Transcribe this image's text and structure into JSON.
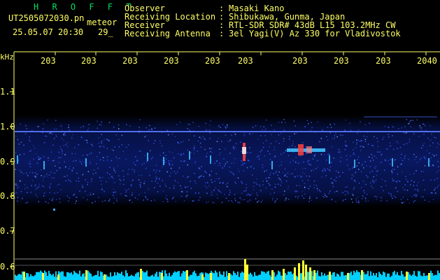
{
  "header": {
    "brand": "H R O F F T",
    "filename": "UT2505072030.pn",
    "meteor_label": "meteor",
    "timestamp": "25.05.07 20:30",
    "count": "29_"
  },
  "info": [
    {
      "label": "Observer",
      "colon": ":",
      "value": "Masaki Kano"
    },
    {
      "label": "Receiving Location",
      "colon": ":",
      "value": "Shibukawa, Gunma, Japan"
    },
    {
      "label": "Receiver",
      "colon": ":",
      "value": "RTL-SDR SDR# 43dB L15 103.2MHz CW"
    },
    {
      "label": "Receiving Antenna",
      "colon": ":",
      "value": "3el Yagi(V) Az 330 for Vladivostok"
    }
  ],
  "axis": {
    "unit": "kHz",
    "x_ticks": [
      "203",
      "203",
      "203",
      "203",
      "203",
      "203",
      "203",
      "203",
      "203",
      "2040"
    ],
    "y_ticks": [
      "1.1",
      "1.0",
      "0.9",
      "0.8",
      "0.7",
      "0.6"
    ]
  },
  "colors": {
    "text": "#ffff66",
    "brand": "#00e060",
    "echo": "#ff4040",
    "band": "#3a5cff",
    "bar": "#ffff33",
    "noise": "#00d0ff"
  }
}
